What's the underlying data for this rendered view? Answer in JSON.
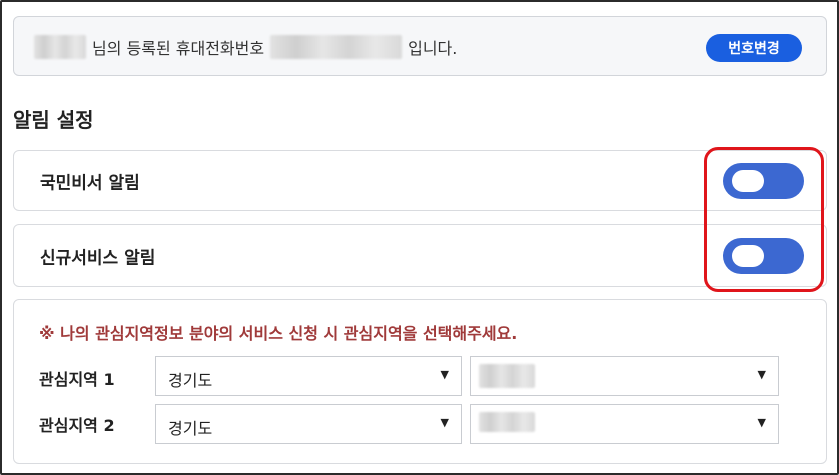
{
  "phone": {
    "name_suffix": "님의 등록된 휴대전화번호",
    "sentence_end": "입니다.",
    "change_button": "번호변경"
  },
  "alert_settings": {
    "title": "알림 설정",
    "toggles": [
      {
        "label": "국민비서 알림",
        "state": "on"
      },
      {
        "label": "신규서비스 알림",
        "state": "on"
      }
    ]
  },
  "regions": {
    "notice": "※ 나의 관심지역정보 분야의 서비스 신청 시 관심지역을 선택해주세요.",
    "items": [
      {
        "label": "관심지역 1",
        "province": "경기도",
        "arrow": "▼"
      },
      {
        "label": "관심지역 2",
        "province": "경기도",
        "arrow": "▼"
      }
    ]
  },
  "colors": {
    "toggle_on": "#3c68d1",
    "button": "#1a5fe0",
    "highlight": "#e0151b",
    "notice_text": "#a03a3a"
  }
}
